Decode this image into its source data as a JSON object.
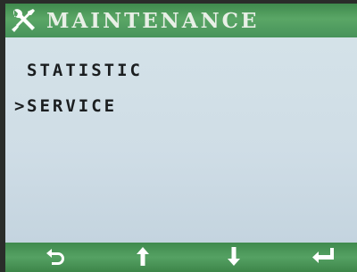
{
  "header": {
    "title": "MAINTENANCE",
    "icon": "tools-icon"
  },
  "menu": {
    "cursor": ">",
    "items": [
      {
        "label": "STATISTIC",
        "selected": false
      },
      {
        "label": "SERVICE",
        "selected": true
      }
    ]
  },
  "footer": {
    "buttons": [
      {
        "icon": "back-icon"
      },
      {
        "icon": "arrow-up-icon"
      },
      {
        "icon": "arrow-down-icon"
      },
      {
        "icon": "enter-icon"
      }
    ]
  },
  "colors": {
    "bar_green": "#4c9a5b",
    "screen_bg": "#cfdde6",
    "text": "#1b1e20"
  }
}
